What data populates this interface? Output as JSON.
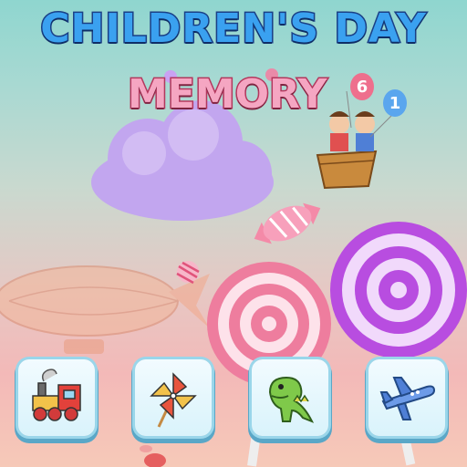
{
  "game": {
    "title": "CHILDREN'S DAY",
    "subtitle": "MEMORY",
    "balloon_numbers": [
      "6",
      "1"
    ]
  },
  "cards": [
    {
      "icon": "train-icon",
      "label": "train"
    },
    {
      "icon": "pinwheel-icon",
      "label": "pinwheel"
    },
    {
      "icon": "dinosaur-icon",
      "label": "dinosaur"
    },
    {
      "icon": "airplane-icon",
      "label": "airplane"
    }
  ],
  "colors": {
    "title_fill": "#3aa1f0",
    "title_stroke": "#1a3f86",
    "subtitle_fill": "#f5a6c2",
    "subtitle_stroke": "#b4375d",
    "card_border": "#9ad6ea"
  }
}
